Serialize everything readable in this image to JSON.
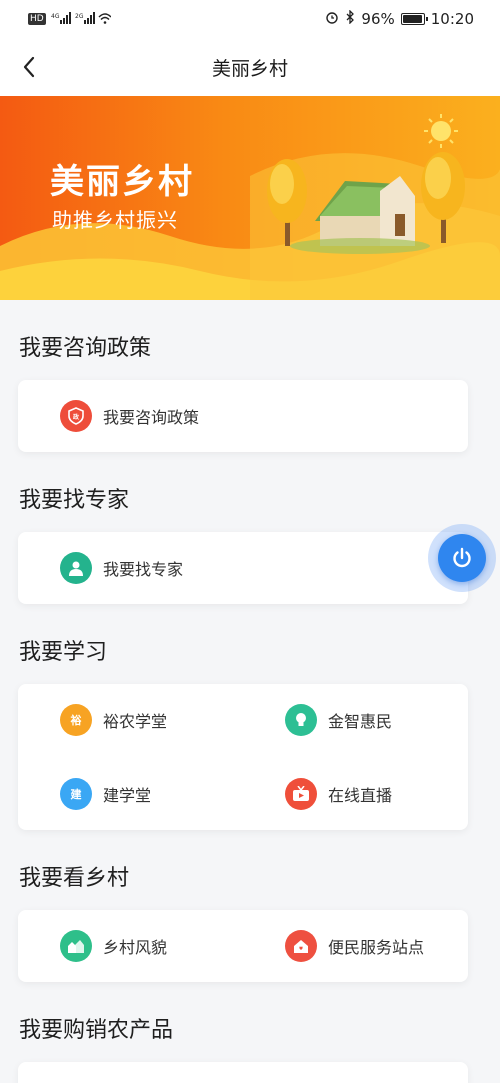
{
  "status": {
    "left_badges": "HD  4G  2G",
    "right": "96%",
    "time": "10:20"
  },
  "nav": {
    "title": "美丽乡村"
  },
  "banner": {
    "title": "美丽乡村",
    "subtitle": "助推乡村振兴"
  },
  "sections": [
    {
      "title": "我要咨询政策",
      "items": [
        {
          "label": "我要咨询政策",
          "icon": "policy-shield-icon",
          "color": "#ee4d3a"
        }
      ]
    },
    {
      "title": "我要找专家",
      "items": [
        {
          "label": "我要找专家",
          "icon": "expert-person-icon",
          "color": "#24b38d"
        }
      ]
    },
    {
      "title": "我要学习",
      "items": [
        {
          "label": "裕农学堂",
          "icon": "yunong-school-icon",
          "color": "#f7a323"
        },
        {
          "label": "金智惠民",
          "icon": "lightbulb-icon",
          "color": "#2dbf94"
        },
        {
          "label": "建学堂",
          "icon": "jian-school-icon",
          "color": "#3aa7f4"
        },
        {
          "label": "在线直播",
          "icon": "live-tv-icon",
          "color": "#ef4f3a"
        }
      ]
    },
    {
      "title": "我要看乡村",
      "items": [
        {
          "label": "乡村风貌",
          "icon": "village-scene-icon",
          "color": "#2ebf8a"
        },
        {
          "label": "便民服务站点",
          "icon": "service-house-icon",
          "color": "#ee5040"
        }
      ]
    },
    {
      "title": "我要购销农产品",
      "items": []
    }
  ],
  "icons": {
    "yunong_glyph": "裕",
    "jian_glyph": "建",
    "policy_glyph": "政"
  },
  "colors": {
    "accent": "#2f86ef",
    "banner_start": "#f45a12",
    "banner_end": "#fbb01e"
  }
}
